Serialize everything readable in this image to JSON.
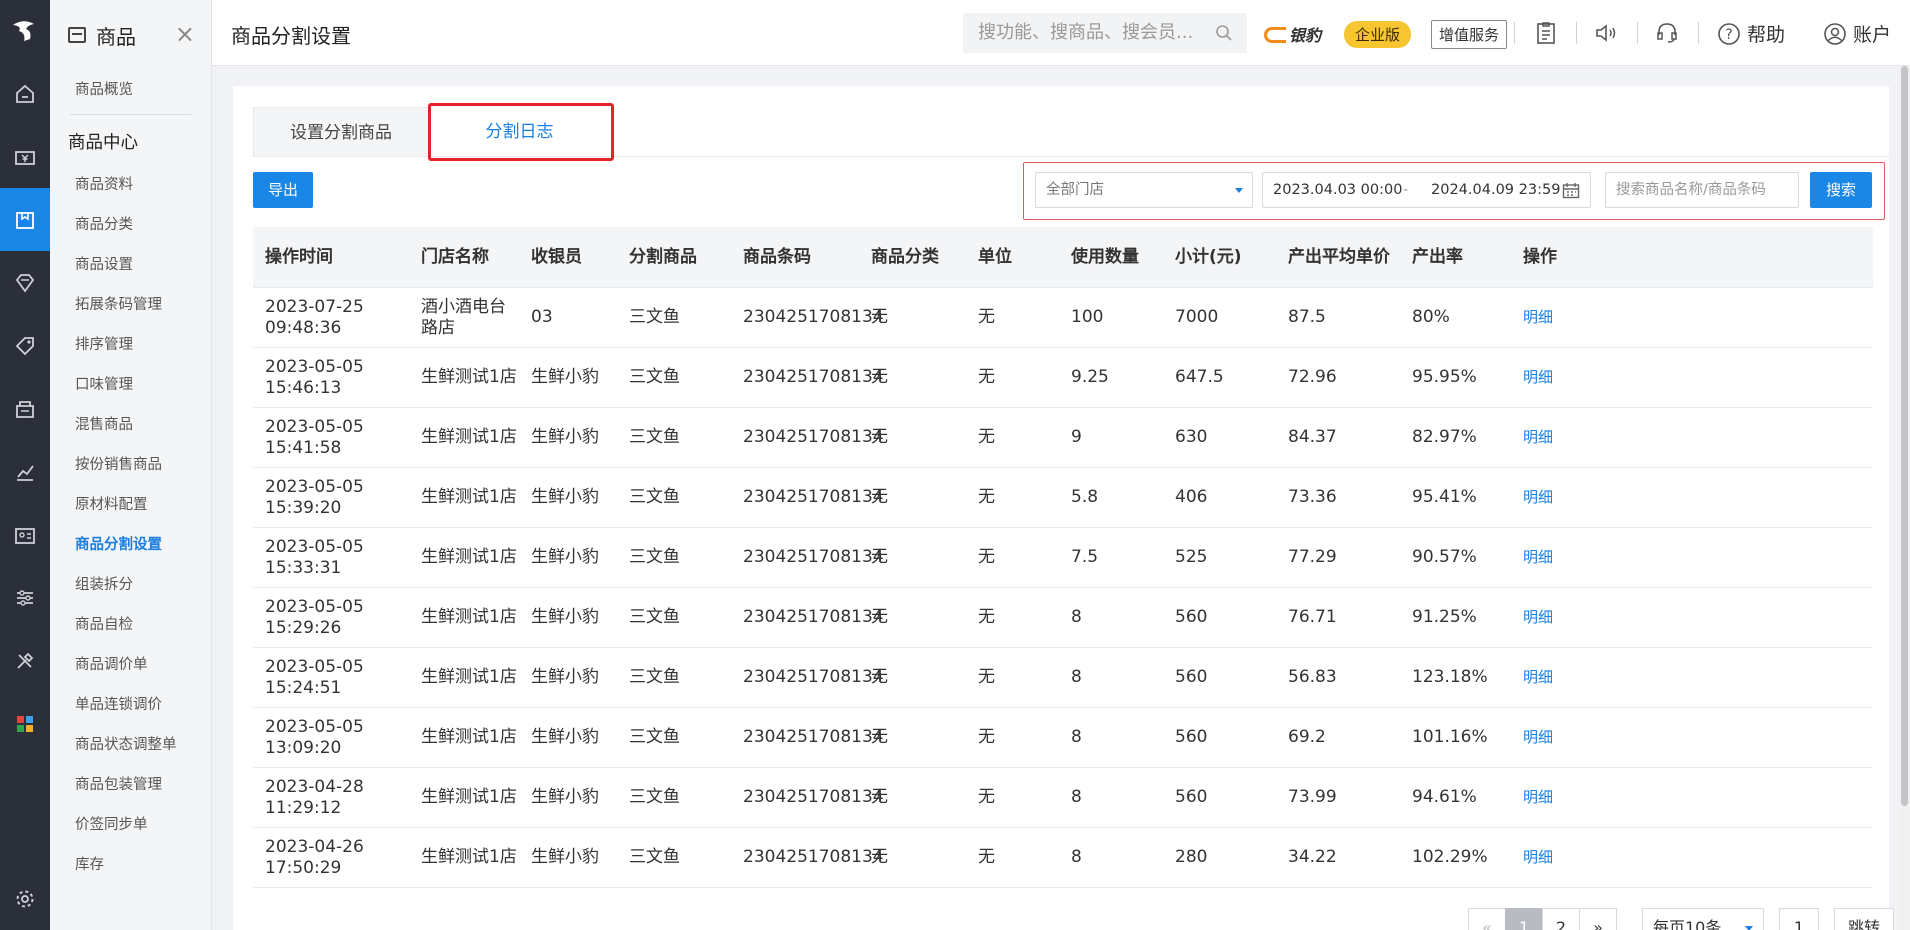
{
  "nav_rail": {
    "items": [
      {
        "name": "home-icon"
      },
      {
        "name": "cashier-icon"
      },
      {
        "name": "product-icon",
        "active": true
      },
      {
        "name": "diamond-icon"
      },
      {
        "name": "tag-icon"
      },
      {
        "name": "store-icon"
      },
      {
        "name": "chart-icon"
      },
      {
        "name": "member-card-icon"
      },
      {
        "name": "settings-sliders-icon"
      },
      {
        "name": "tools-icon"
      },
      {
        "name": "apps-icon"
      }
    ],
    "bottom": {
      "name": "gear-icon"
    }
  },
  "sidebar": {
    "title": "商品",
    "overview": "商品概览",
    "group": "商品中心",
    "items": [
      {
        "label": "商品资料"
      },
      {
        "label": "商品分类"
      },
      {
        "label": "商品设置"
      },
      {
        "label": "拓展条码管理"
      },
      {
        "label": "排序管理"
      },
      {
        "label": "口味管理"
      },
      {
        "label": "混售商品"
      },
      {
        "label": "按份销售商品"
      },
      {
        "label": "原材料配置"
      },
      {
        "label": "商品分割设置",
        "active": true
      },
      {
        "label": "组装拆分"
      },
      {
        "label": "商品自检"
      },
      {
        "label": "商品调价单"
      },
      {
        "label": "单品连锁调价"
      },
      {
        "label": "商品状态调整单"
      },
      {
        "label": "商品包装管理"
      },
      {
        "label": "价签同步单"
      },
      {
        "label": "库存"
      }
    ]
  },
  "topbar": {
    "page_title": "商品分割设置",
    "search_placeholder": "搜功能、搜商品、搜会员...",
    "brand": "银豹",
    "edition": "企业版",
    "value_added": "增值服务",
    "help": "帮助",
    "account": "账户"
  },
  "tabs": {
    "setup": "设置分割商品",
    "log": "分割日志",
    "active": "log"
  },
  "toolbar": {
    "export": "导出",
    "store_select": "全部门店",
    "date_start": "2023.04.03 00:00",
    "date_sep": "-",
    "date_end": "2024.04.09 23:59",
    "keyword_placeholder": "搜索商品名称/商品条码",
    "search": "搜索"
  },
  "table": {
    "columns": [
      "操作时间",
      "门店名称",
      "收银员",
      "分割商品",
      "商品条码",
      "商品分类",
      "单位",
      "使用数量",
      "小计(元)",
      "产出平均单价",
      "产出率",
      "操作"
    ],
    "rows": [
      {
        "date": "2023-07-25",
        "time": "09:48:36",
        "store": "酒小酒电台路店",
        "cashier": "03",
        "product": "三文鱼",
        "barcode": "2304251708134",
        "category": "无",
        "unit": "无",
        "qty": "100",
        "subtotal": "7000",
        "avg_price": "87.5",
        "yield": "80%",
        "action": "明细"
      },
      {
        "date": "2023-05-05",
        "time": "15:46:13",
        "store": "生鲜测试1店",
        "cashier": "生鲜小豹",
        "product": "三文鱼",
        "barcode": "2304251708134",
        "category": "无",
        "unit": "无",
        "qty": "9.25",
        "subtotal": "647.5",
        "avg_price": "72.96",
        "yield": "95.95%",
        "action": "明细"
      },
      {
        "date": "2023-05-05",
        "time": "15:41:58",
        "store": "生鲜测试1店",
        "cashier": "生鲜小豹",
        "product": "三文鱼",
        "barcode": "2304251708134",
        "category": "无",
        "unit": "无",
        "qty": "9",
        "subtotal": "630",
        "avg_price": "84.37",
        "yield": "82.97%",
        "action": "明细"
      },
      {
        "date": "2023-05-05",
        "time": "15:39:20",
        "store": "生鲜测试1店",
        "cashier": "生鲜小豹",
        "product": "三文鱼",
        "barcode": "2304251708134",
        "category": "无",
        "unit": "无",
        "qty": "5.8",
        "subtotal": "406",
        "avg_price": "73.36",
        "yield": "95.41%",
        "action": "明细"
      },
      {
        "date": "2023-05-05",
        "time": "15:33:31",
        "store": "生鲜测试1店",
        "cashier": "生鲜小豹",
        "product": "三文鱼",
        "barcode": "2304251708134",
        "category": "无",
        "unit": "无",
        "qty": "7.5",
        "subtotal": "525",
        "avg_price": "77.29",
        "yield": "90.57%",
        "action": "明细"
      },
      {
        "date": "2023-05-05",
        "time": "15:29:26",
        "store": "生鲜测试1店",
        "cashier": "生鲜小豹",
        "product": "三文鱼",
        "barcode": "2304251708134",
        "category": "无",
        "unit": "无",
        "qty": "8",
        "subtotal": "560",
        "avg_price": "76.71",
        "yield": "91.25%",
        "action": "明细"
      },
      {
        "date": "2023-05-05",
        "time": "15:24:51",
        "store": "生鲜测试1店",
        "cashier": "生鲜小豹",
        "product": "三文鱼",
        "barcode": "2304251708134",
        "category": "无",
        "unit": "无",
        "qty": "8",
        "subtotal": "560",
        "avg_price": "56.83",
        "yield": "123.18%",
        "action": "明细"
      },
      {
        "date": "2023-05-05",
        "time": "13:09:20",
        "store": "生鲜测试1店",
        "cashier": "生鲜小豹",
        "product": "三文鱼",
        "barcode": "2304251708134",
        "category": "无",
        "unit": "无",
        "qty": "8",
        "subtotal": "560",
        "avg_price": "69.2",
        "yield": "101.16%",
        "action": "明细"
      },
      {
        "date": "2023-04-28",
        "time": "11:29:12",
        "store": "生鲜测试1店",
        "cashier": "生鲜小豹",
        "product": "三文鱼",
        "barcode": "2304251708134",
        "category": "无",
        "unit": "无",
        "qty": "8",
        "subtotal": "560",
        "avg_price": "73.99",
        "yield": "94.61%",
        "action": "明细"
      },
      {
        "date": "2023-04-26",
        "time": "17:50:29",
        "store": "生鲜测试1店",
        "cashier": "生鲜小豹",
        "product": "三文鱼",
        "barcode": "2304251708134",
        "category": "无",
        "unit": "无",
        "qty": "8",
        "subtotal": "280",
        "avg_price": "34.22",
        "yield": "102.29%",
        "action": "明细"
      }
    ]
  },
  "pagination": {
    "prev": "«",
    "pages": [
      "1",
      "2"
    ],
    "current": "1",
    "next": "»",
    "page_size": "每页10条",
    "goto_value": "1",
    "jump": "跳转"
  },
  "colors": {
    "accent": "#1a86e6",
    "rail_bg": "#2b2f3a",
    "highlight_red": "#e0262b",
    "edition_badge": "#f7c530"
  }
}
